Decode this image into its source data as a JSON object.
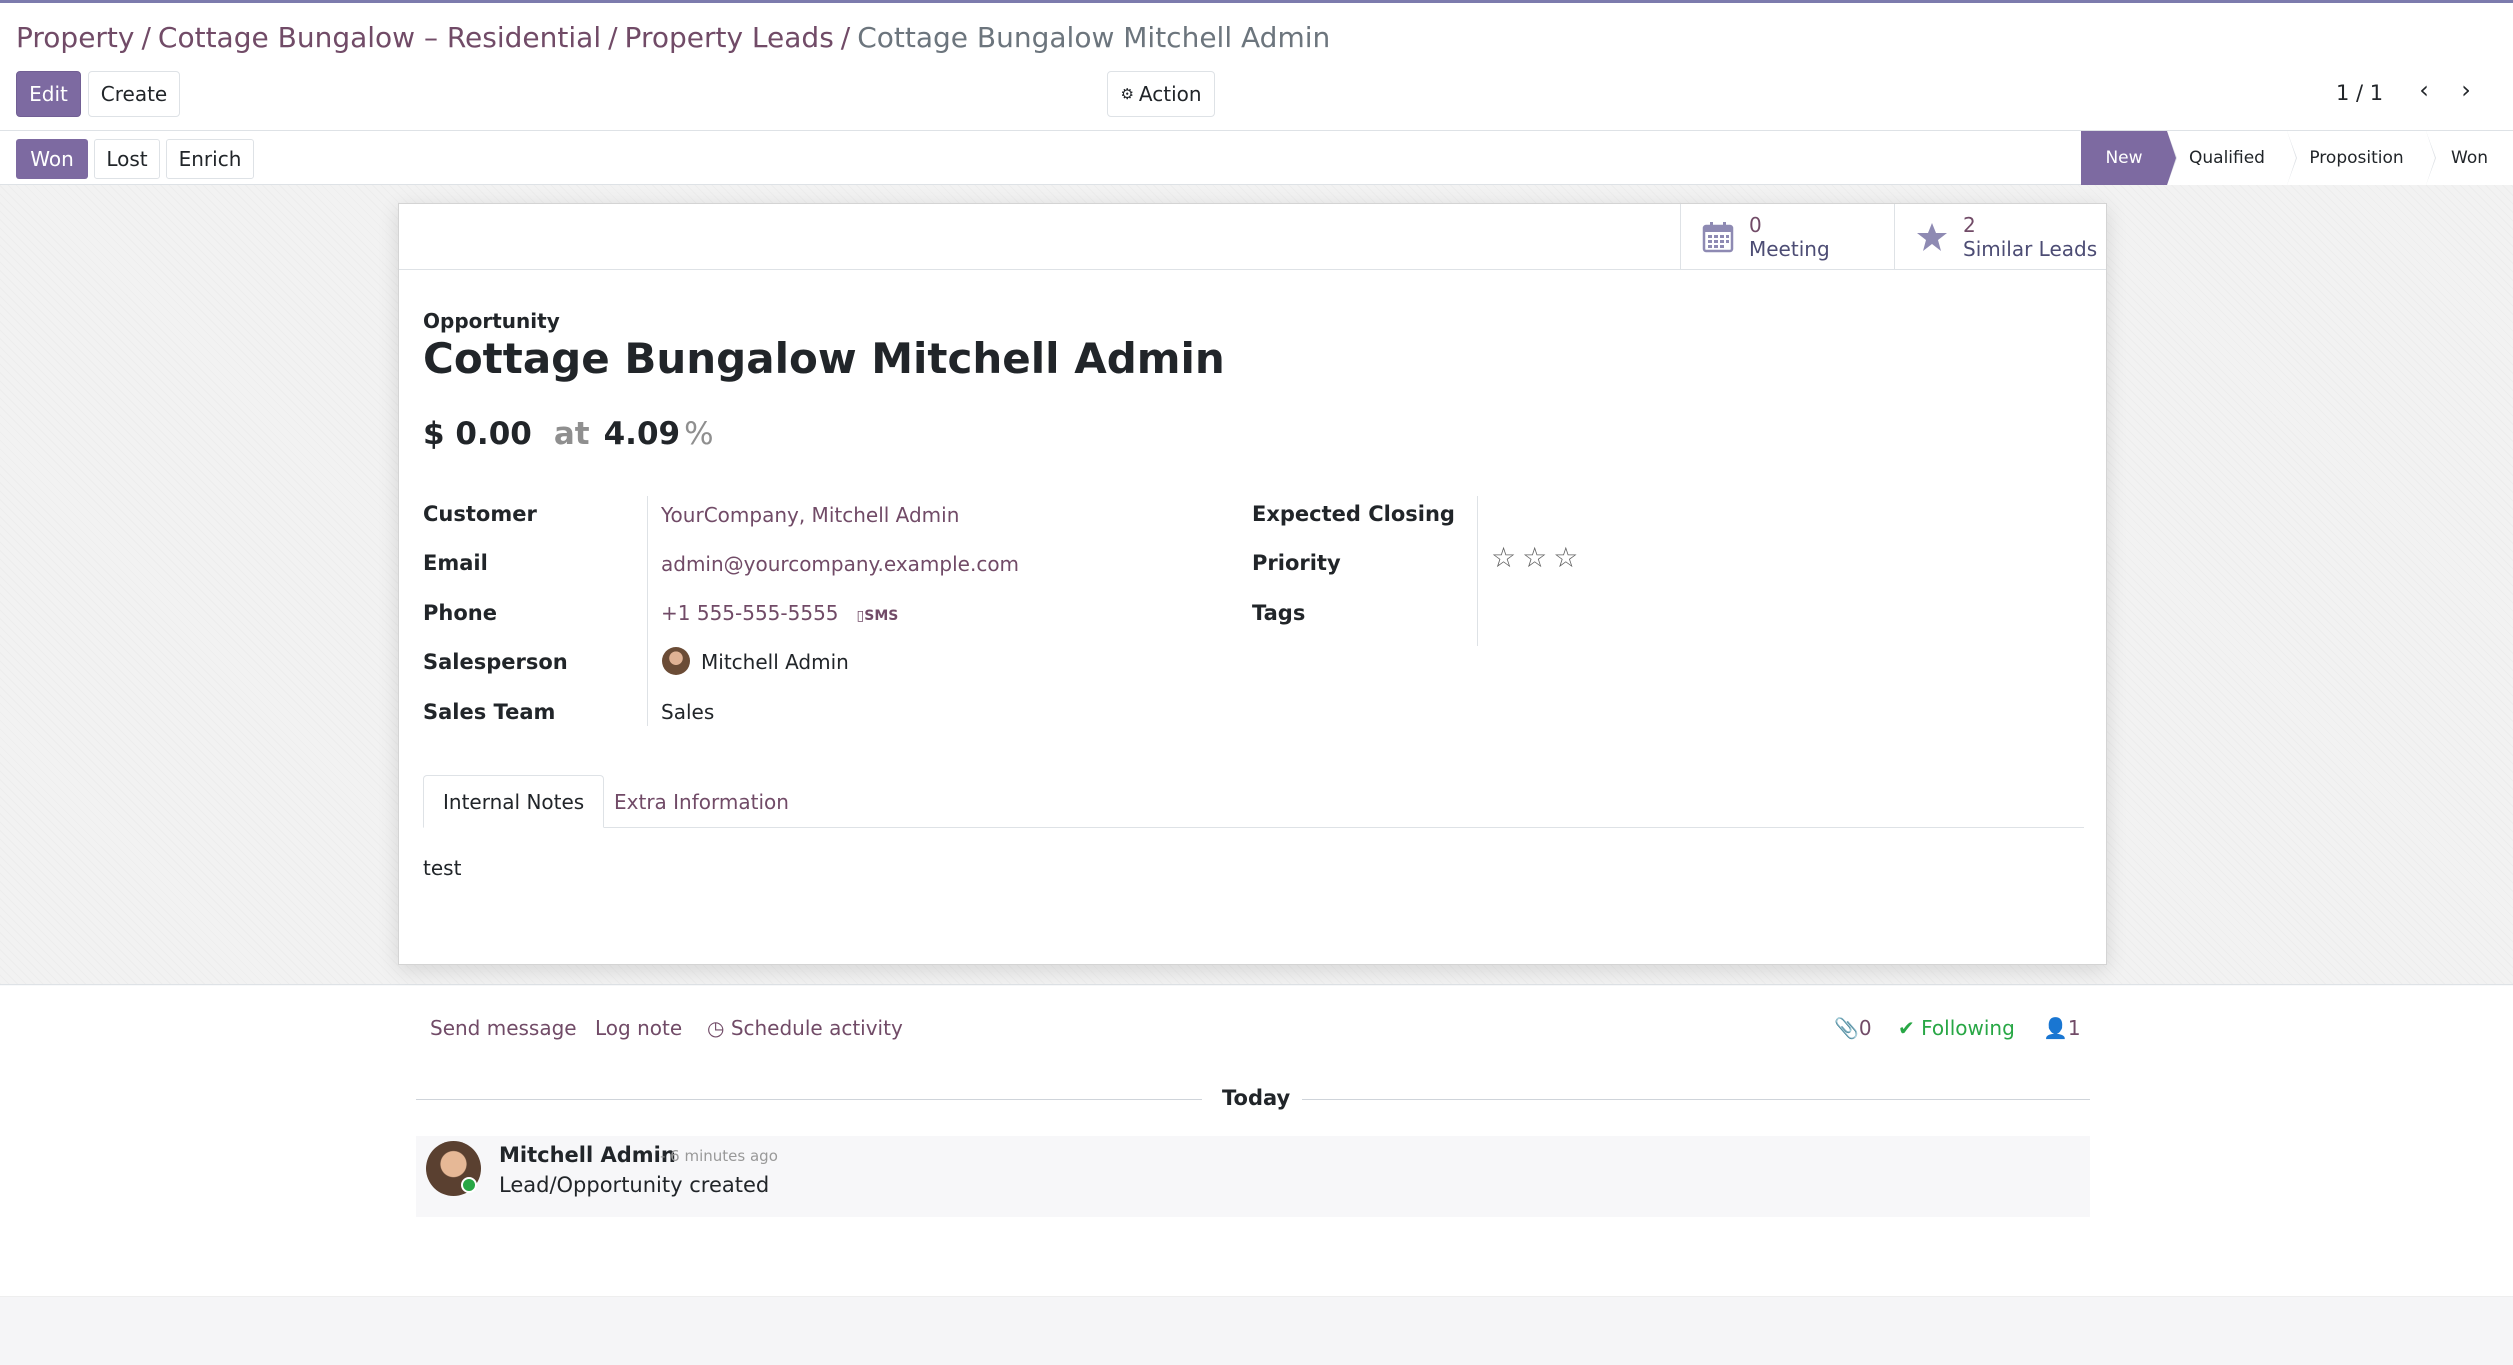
{
  "breadcrumb": {
    "items": [
      "Property",
      "Cottage Bungalow – Residential",
      "Property Leads"
    ],
    "separator": "/",
    "current": "Cottage Bungalow Mitchell Admin"
  },
  "toolbar": {
    "edit_label": "Edit",
    "create_label": "Create",
    "action_label": "Action",
    "pager": "1 / 1"
  },
  "statusbar": {
    "won_label": "Won",
    "lost_label": "Lost",
    "enrich_label": "Enrich",
    "stages": [
      "New",
      "Qualified",
      "Proposition",
      "Won"
    ],
    "active_stage": "New"
  },
  "stat_buttons": {
    "meeting": {
      "count": "0",
      "label": "Meeting"
    },
    "similar": {
      "count": "2",
      "label": "Similar Leads"
    }
  },
  "record": {
    "type_label": "Opportunity",
    "title": "Cottage Bungalow Mitchell Admin",
    "revenue": "$ 0.00",
    "at_label": "at",
    "probability": "4.09",
    "pct_sign": "%"
  },
  "fields": {
    "customer_label": "Customer",
    "customer_value": "YourCompany, Mitchell Admin",
    "email_label": "Email",
    "email_value": "admin@yourcompany.example.com",
    "phone_label": "Phone",
    "phone_value": "+1 555-555-5555",
    "sms_label": "SMS",
    "salesperson_label": "Salesperson",
    "salesperson_value": "Mitchell Admin",
    "sales_team_label": "Sales Team",
    "sales_team_value": "Sales",
    "expected_closing_label": "Expected Closing",
    "priority_label": "Priority",
    "priority_stars": 0,
    "tags_label": "Tags"
  },
  "tabs": {
    "internal_notes": "Internal Notes",
    "extra_information": "Extra Information",
    "notes_content": "test"
  },
  "chatter": {
    "send_message": "Send message",
    "log_note": "Log note",
    "schedule_activity": "Schedule activity",
    "attachments_count": "0",
    "following_label": "Following",
    "followers_count": "1",
    "today_label": "Today",
    "message": {
      "author": "Mitchell Admin",
      "date": "- 6 minutes ago",
      "body": "Lead/Opportunity created"
    }
  },
  "colors": {
    "primary": "#7d6aa1",
    "link": "#714b67",
    "following": "#28a745"
  }
}
